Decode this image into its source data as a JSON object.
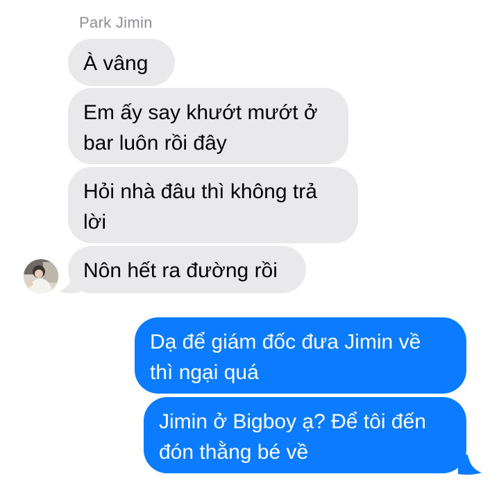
{
  "conversation": {
    "sender_name": "Park Jimin",
    "incoming": [
      {
        "lines": [
          "À vâng"
        ]
      },
      {
        "lines": [
          "Em ấy say khướt mướt ở",
          "bar luôn rồi đây"
        ]
      },
      {
        "lines": [
          "Hỏi nhà đâu thì không trả",
          "lời"
        ]
      },
      {
        "lines": [
          "Nôn hết ra đường rồi"
        ]
      }
    ],
    "outgoing": [
      {
        "lines": [
          "Dạ để giám đốc đưa Jimin về",
          "thì ngại quá"
        ]
      },
      {
        "lines": [
          "Jimin ở Bigboy ạ? Để tôi đến",
          "đón thằng bé về"
        ]
      }
    ]
  },
  "colors": {
    "incoming_bubble": "#e9e9eb",
    "outgoing_bubble": "#0b7cff",
    "sender_name": "#8e8e93"
  },
  "icons": {
    "avatar": "contact-avatar-photo"
  }
}
